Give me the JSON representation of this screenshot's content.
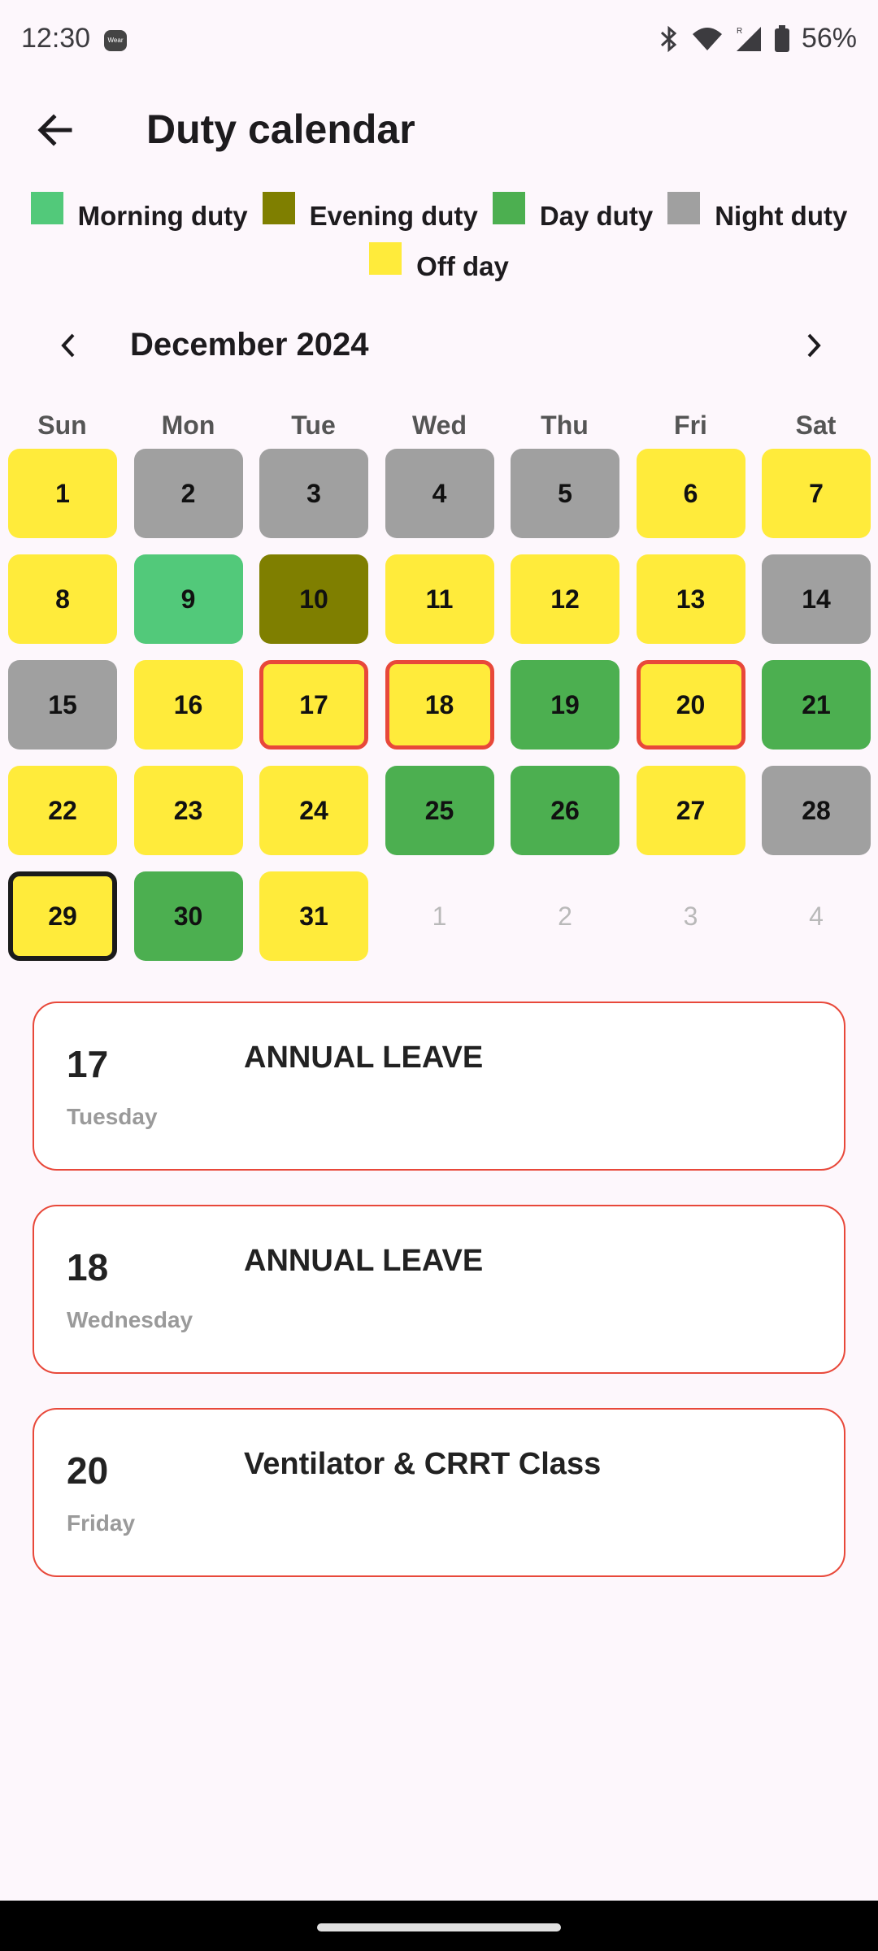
{
  "status": {
    "time": "12:30",
    "wear_icon": "Wear",
    "battery": "56%"
  },
  "appbar": {
    "title": "Duty calendar"
  },
  "legend": [
    {
      "label": "Morning duty",
      "color": "#52c97a"
    },
    {
      "label": "Evening duty",
      "color": "#7f7f00"
    },
    {
      "label": "Day duty",
      "color": "#4caf50"
    },
    {
      "label": "Night duty",
      "color": "#a0a0a0"
    },
    {
      "label": "Off day",
      "color": "#ffeb3b"
    }
  ],
  "calendar": {
    "month_label": "December 2024",
    "weekdays": [
      "Sun",
      "Mon",
      "Tue",
      "Wed",
      "Thu",
      "Fri",
      "Sat"
    ],
    "days": [
      {
        "n": "1",
        "t": "off"
      },
      {
        "n": "2",
        "t": "night"
      },
      {
        "n": "3",
        "t": "night"
      },
      {
        "n": "4",
        "t": "night"
      },
      {
        "n": "5",
        "t": "night"
      },
      {
        "n": "6",
        "t": "off"
      },
      {
        "n": "7",
        "t": "off"
      },
      {
        "n": "8",
        "t": "off"
      },
      {
        "n": "9",
        "t": "morning"
      },
      {
        "n": "10",
        "t": "evening"
      },
      {
        "n": "11",
        "t": "off"
      },
      {
        "n": "12",
        "t": "off"
      },
      {
        "n": "13",
        "t": "off"
      },
      {
        "n": "14",
        "t": "night"
      },
      {
        "n": "15",
        "t": "night"
      },
      {
        "n": "16",
        "t": "off"
      },
      {
        "n": "17",
        "t": "off",
        "event": true
      },
      {
        "n": "18",
        "t": "off",
        "event": true
      },
      {
        "n": "19",
        "t": "day"
      },
      {
        "n": "20",
        "t": "off",
        "event": true
      },
      {
        "n": "21",
        "t": "day"
      },
      {
        "n": "22",
        "t": "off"
      },
      {
        "n": "23",
        "t": "off"
      },
      {
        "n": "24",
        "t": "off"
      },
      {
        "n": "25",
        "t": "day"
      },
      {
        "n": "26",
        "t": "day"
      },
      {
        "n": "27",
        "t": "off"
      },
      {
        "n": "28",
        "t": "night"
      },
      {
        "n": "29",
        "t": "off",
        "today": true
      },
      {
        "n": "30",
        "t": "day"
      },
      {
        "n": "31",
        "t": "off"
      },
      {
        "n": "1",
        "t": "outside"
      },
      {
        "n": "2",
        "t": "outside"
      },
      {
        "n": "3",
        "t": "outside"
      },
      {
        "n": "4",
        "t": "outside"
      }
    ]
  },
  "events": [
    {
      "day": "17",
      "weekday": "Tuesday",
      "title": "ANNUAL LEAVE"
    },
    {
      "day": "18",
      "weekday": "Wednesday",
      "title": "ANNUAL LEAVE"
    },
    {
      "day": "20",
      "weekday": "Friday",
      "title": "Ventilator & CRRT Class"
    }
  ],
  "colors": {
    "morning": "#52c97a",
    "evening": "#7f7f00",
    "day": "#4caf50",
    "night": "#a0a0a0",
    "off": "#ffeb3b",
    "event_border": "#e8483a"
  }
}
